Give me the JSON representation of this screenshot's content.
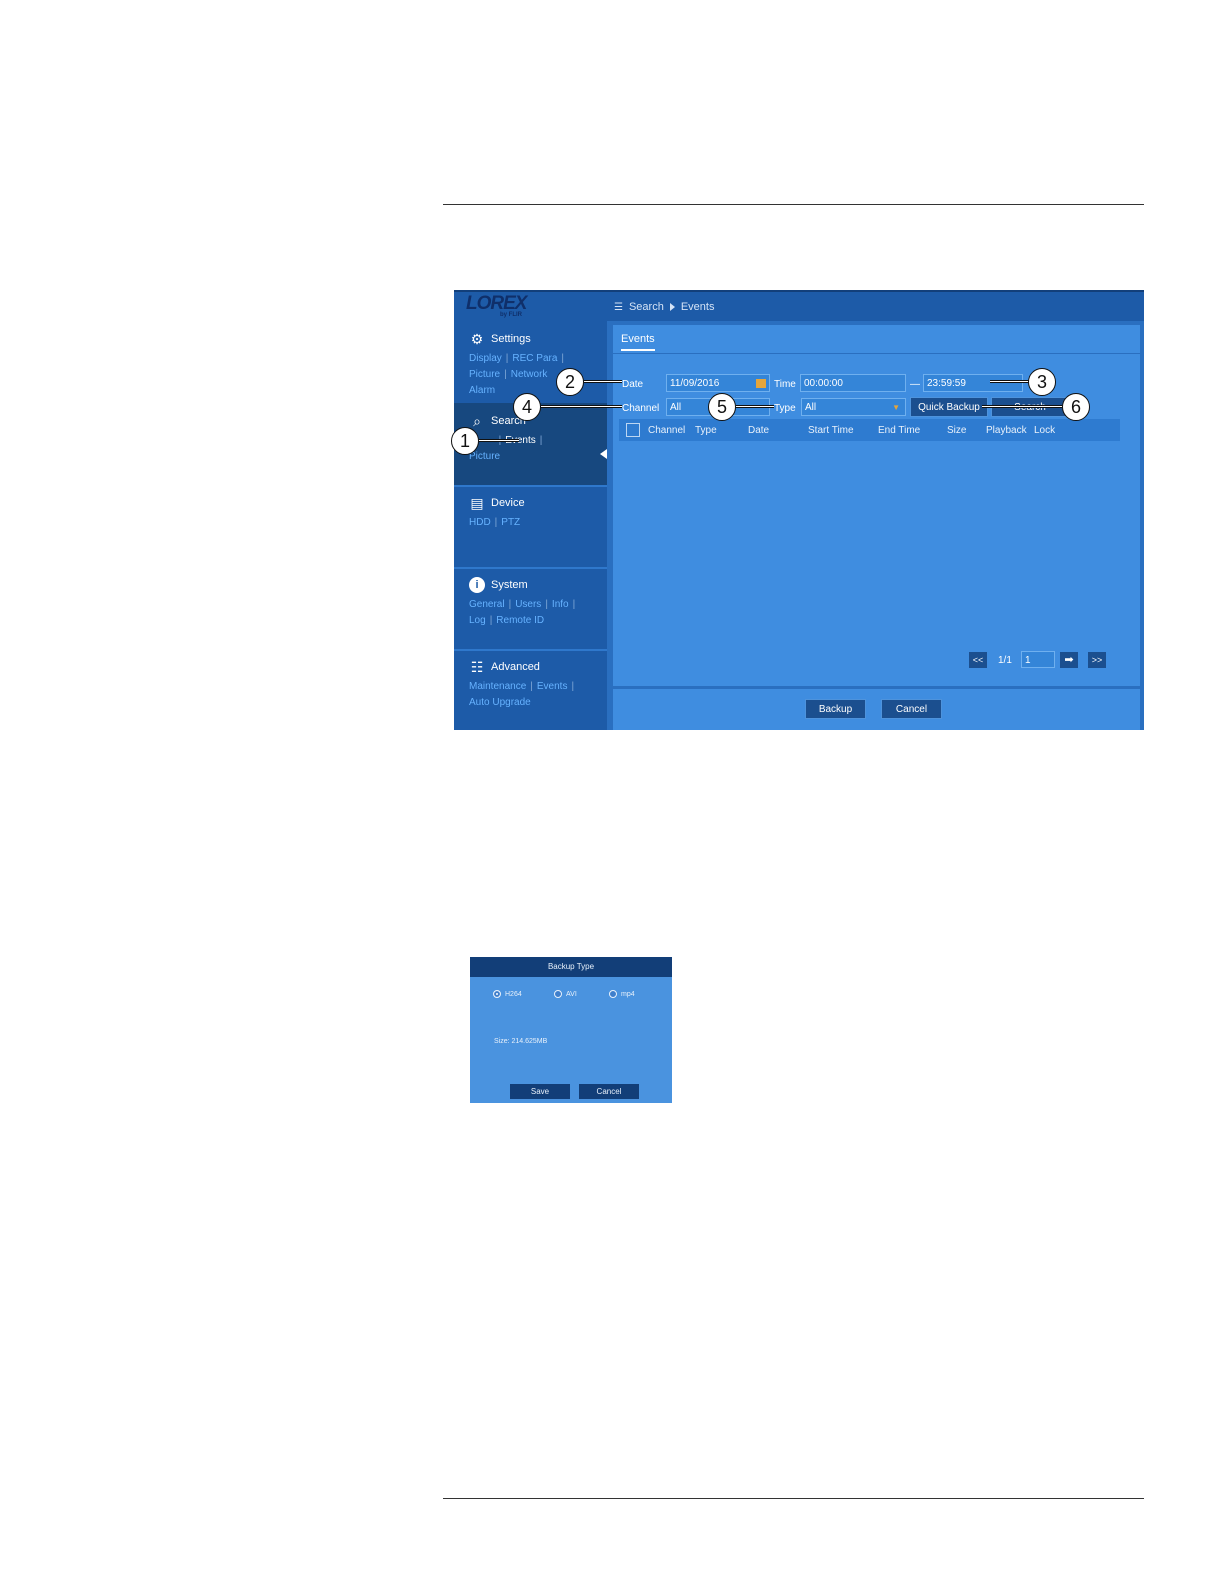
{
  "app": {
    "logo": "LOREX",
    "logo_sub": "by FLIR",
    "breadcrumb": [
      "Search",
      "Events"
    ]
  },
  "sidebar": {
    "sections": [
      {
        "title": "Settings",
        "icon": "gear-icon",
        "links": [
          "Display",
          "REC Para",
          "Picture",
          "Network",
          "Alarm"
        ]
      },
      {
        "title": "Search",
        "icon": "search-icon",
        "links": [
          "Event",
          "Events",
          "Picture"
        ]
      },
      {
        "title": "Device",
        "icon": "device-icon",
        "links": [
          "HDD",
          "PTZ"
        ]
      },
      {
        "title": "System",
        "icon": "info-icon",
        "links": [
          "General",
          "Users",
          "Info",
          "Log",
          "Remote ID"
        ]
      },
      {
        "title": "Advanced",
        "icon": "advanced-icon",
        "links": [
          "Maintenance",
          "Events",
          "Auto Upgrade"
        ]
      }
    ]
  },
  "content": {
    "tab": "Events",
    "date_label": "Date",
    "date_value": "11/09/2016",
    "time_label": "Time",
    "time_start": "00:00:00",
    "time_dash": "—",
    "time_end": "23:59:59",
    "channel_label": "Channel",
    "channel_value": "All",
    "type_label": "Type",
    "type_value": "All",
    "quick_backup": "Quick Backup",
    "search": "Search",
    "columns": [
      "Channel",
      "Type",
      "Date",
      "Start Time",
      "End Time",
      "Size",
      "Playback",
      "Lock"
    ],
    "pager": {
      "first": "<<",
      "page": "1/1",
      "input": "1",
      "last": ">>"
    },
    "backup": "Backup",
    "cancel": "Cancel"
  },
  "callouts": [
    "1",
    "2",
    "3",
    "4",
    "5",
    "6"
  ],
  "dialog": {
    "title": "Backup Type",
    "options": [
      "H264",
      "AVI",
      "mp4"
    ],
    "selected": "H264",
    "size": "Size: 214.625MB",
    "save": "Save",
    "cancel": "Cancel"
  }
}
